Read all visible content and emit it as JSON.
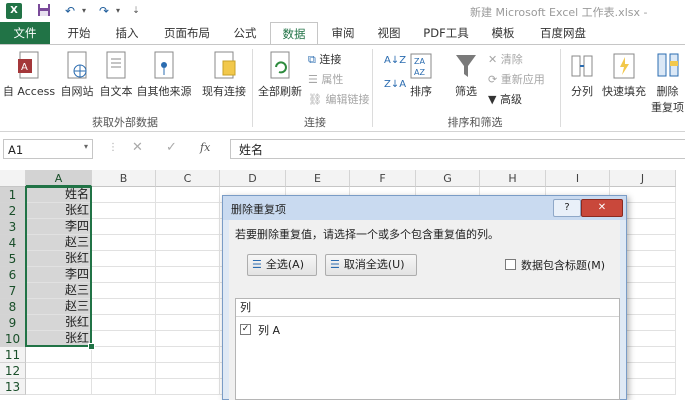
{
  "window": {
    "title": "新建 Microsoft Excel 工作表.xlsx -"
  },
  "quick_access": [
    "excel-logo-icon",
    "save-icon",
    "undo-icon",
    "undo-dropdown-icon",
    "redo-icon",
    "redo-dropdown-icon",
    "customize-icon"
  ],
  "tabs": [
    "文件",
    "开始",
    "插入",
    "页面布局",
    "公式",
    "数据",
    "审阅",
    "视图",
    "PDF工具",
    "模板",
    "百度网盘"
  ],
  "active_tab": "数据",
  "ribbon": {
    "external": {
      "access": "自 Access",
      "web": "自网站",
      "text": "自文本",
      "other": "自其他来源",
      "existing": "现有连接",
      "label": "获取外部数据"
    },
    "connections": {
      "refresh_all": "全部刷新",
      "connections": "连接",
      "properties": "属性",
      "edit_links": "编辑链接",
      "label": "连接"
    },
    "sort_filter": {
      "sort": "排序",
      "filter": "筛选",
      "clear": "清除",
      "reapply": "重新应用",
      "advanced": "高级",
      "label": "排序和筛选"
    },
    "tools": {
      "split": "分列",
      "flash_fill": "快速填充",
      "remove_dup_1": "删除",
      "remove_dup_2": "重复项"
    }
  },
  "formula_bar": {
    "name_box": "A1",
    "fx": "fx",
    "value": "姓名"
  },
  "columns": [
    "A",
    "B",
    "C",
    "D",
    "E",
    "F",
    "G",
    "H",
    "I",
    "J"
  ],
  "rows": [
    "1",
    "2",
    "3",
    "4",
    "5",
    "6",
    "7",
    "8",
    "9",
    "10",
    "11",
    "12",
    "13"
  ],
  "cells_A": [
    "姓名",
    "张红",
    "李四",
    "赵三",
    "张红",
    "李四",
    "赵三",
    "赵三",
    "张红",
    "张红"
  ],
  "dialog": {
    "title": "删除重复项",
    "help": "?",
    "close": "✕",
    "instruction": "若要删除重复值，请选择一个或多个包含重复值的列。",
    "select_all": "全选(A)",
    "unselect_all": "取消全选(U)",
    "header_checkbox": "数据包含标题(M)",
    "list_header": "列",
    "column_item": "列 A"
  }
}
